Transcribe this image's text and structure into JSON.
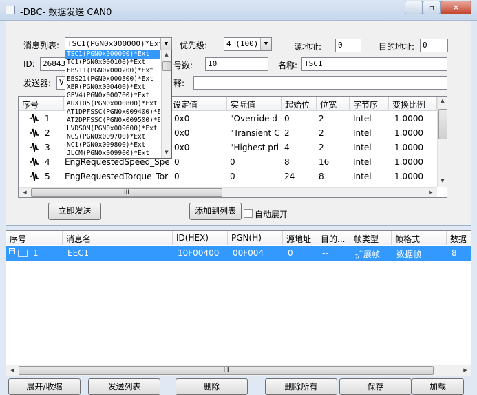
{
  "window": {
    "title": "-DBC- 数据发送 CAN0",
    "buttons": [
      "–",
      "▫",
      "✕"
    ]
  },
  "form": {
    "message_list_label": "消息列表:",
    "message_list_value": "TSC1(PGN0x000000)*Ext",
    "priority_label": "优先级:",
    "priority_value": "4 (100)",
    "source_addr_label": "源地址:",
    "source_addr_value": "0",
    "dest_addr_label": "目的地址:",
    "dest_addr_value": "0",
    "id_label": "ID:",
    "id_value": "2684354",
    "signal_count_label": "号数:",
    "signal_count_value": "10",
    "name_label": "名称:",
    "name_value": "TSC1",
    "sender_label": "发送器:",
    "sender_value": "V",
    "comment_label": "释:",
    "comment_value": ""
  },
  "dropdown": {
    "items": [
      "TSC1(PGN0x000000)*Ext",
      "TC1(PGN0x000100)*Ext",
      "EBS11(PGN0x000200)*Ext",
      "EBS21(PGN0x000300)*Ext",
      "XBR(PGN0x000400)*Ext",
      "GPV4(PGN0x000700)*Ext",
      "AUXIO5(PGN0x000800)*Ext",
      "AT1DPFSSC(PGN0x009400)*Ex",
      "AT2DPFSSC(PGN0x009500)*Ex",
      "LVDSOM(PGN0x009600)*Ext",
      "NCS(PGN0x009700)*Ext",
      "NC1(PGN0x009800)*Ext",
      "JLCM(PGN0x009900)*Ext"
    ],
    "selected_index": 0
  },
  "signals": {
    "headers": [
      "序号",
      "",
      "设定值",
      "实际值",
      "起始位",
      "位宽",
      "字节序",
      "变换比例"
    ],
    "rows": [
      {
        "no": "1",
        "name": "",
        "set": "0x0",
        "actual": "\"Override d",
        "start": "0",
        "width": "2",
        "order": "Intel",
        "scale": "1.0000"
      },
      {
        "no": "2",
        "name": "",
        "set": "0x0",
        "actual": "\"Transient C",
        "start": "2",
        "width": "2",
        "order": "Intel",
        "scale": "1.0000"
      },
      {
        "no": "3",
        "name": "",
        "set": "0x0",
        "actual": "\"Highest pri",
        "start": "4",
        "width": "2",
        "order": "Intel",
        "scale": "1.0000"
      },
      {
        "no": "4",
        "name": "EngRequestedSpeed_Spe",
        "set": "0",
        "actual": "0",
        "start": "8",
        "width": "16",
        "order": "Intel",
        "scale": "1.0000"
      },
      {
        "no": "5",
        "name": "EngRequestedTorque_Tor",
        "set": "0",
        "actual": "0",
        "start": "24",
        "width": "8",
        "order": "Intel",
        "scale": "1.0000"
      }
    ],
    "hscroll_label": "III"
  },
  "actions": {
    "send_now": "立即发送",
    "add_to_list": "添加到列表",
    "auto_expand": "自动展开"
  },
  "send_list": {
    "headers": [
      "序号",
      "消息名",
      "ID(HEX)",
      "PGN(H)",
      "源地址",
      "目的...",
      "帧类型",
      "帧格式",
      "数据"
    ],
    "rows": [
      {
        "expand": "+",
        "no": "1",
        "name": "EEC1",
        "id": "10F00400",
        "pgn": "00F004",
        "src": "0",
        "dst": "--",
        "ftype": "扩展帧",
        "fformat": "数据帧",
        "len": "8"
      }
    ],
    "hscroll_label": "III"
  },
  "bottom_buttons": [
    "展开/收缩",
    "发送列表",
    "删除",
    "删除所有",
    "保存",
    "加载"
  ],
  "colors": {
    "selection": "#3399ff",
    "window_bg": "#dfe8f3",
    "panel_bg": "#f0f0f0"
  }
}
